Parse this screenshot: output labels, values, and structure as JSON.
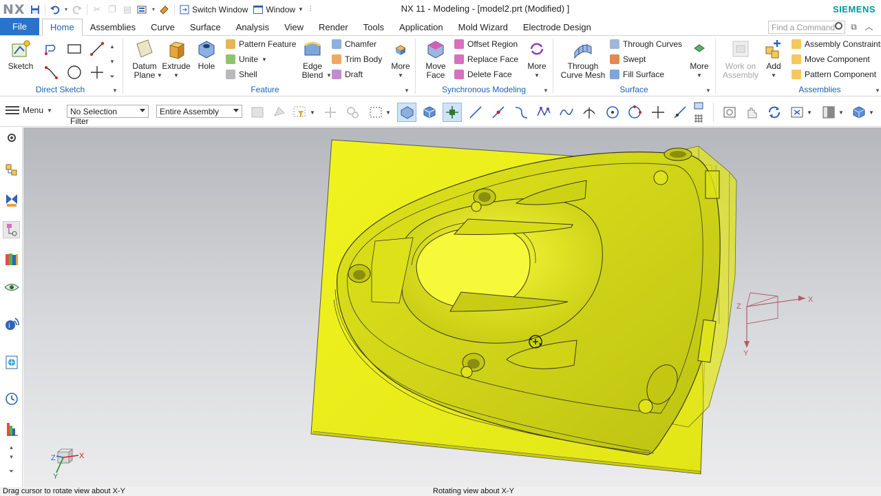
{
  "app": {
    "logo": "NX",
    "title": "NX 11 - Modeling - [model2.prt (Modified) ]",
    "brand": "SIEMENS",
    "switch_window": "Switch Window",
    "window_menu": "Window"
  },
  "tabs": [
    "File",
    "Home",
    "Assemblies",
    "Curve",
    "Surface",
    "Analysis",
    "View",
    "Render",
    "Tools",
    "Application",
    "Mold Wizard",
    "Electrode Design"
  ],
  "active_tab": "Home",
  "search": {
    "placeholder": "Find a Command"
  },
  "ribbon": {
    "direct_sketch": {
      "label": "Direct Sketch",
      "sketch": "Sketch"
    },
    "feature": {
      "label": "Feature",
      "datum_plane": "Datum Plane",
      "extrude": "Extrude",
      "hole": "Hole",
      "pattern_feature": "Pattern Feature",
      "unite": "Unite",
      "shell": "Shell",
      "edge_blend": "Edge Blend",
      "chamfer": "Chamfer",
      "trim_body": "Trim Body",
      "draft": "Draft",
      "more": "More"
    },
    "synchronous": {
      "label": "Synchronous Modeling",
      "move_face": "Move Face",
      "offset_region": "Offset Region",
      "replace_face": "Replace Face",
      "delete_face": "Delete Face",
      "more": "More"
    },
    "surface": {
      "label": "Surface",
      "through_curve_mesh": "Through Curve Mesh",
      "through_curves": "Through Curves",
      "swept": "Swept",
      "fill_surface": "Fill Surface",
      "more": "More"
    },
    "assemblies": {
      "label": "Assemblies",
      "work_on_assembly": "Work on Assembly",
      "add": "Add",
      "assembly_constraints": "Assembly Constraints",
      "move_component": "Move Component",
      "pattern_component": "Pattern Component"
    }
  },
  "toolbar2": {
    "menu": "Menu",
    "selection_filter": "No Selection Filter",
    "scope": "Entire Assembly"
  },
  "viewport": {
    "triad_x": "X",
    "triad_y": "Y",
    "triad_z": "Z",
    "view_triad_x": "X",
    "view_triad_y": "Y",
    "view_triad_z": "Z"
  },
  "status": {
    "left": "Drag cursor to rotate view about X-Y",
    "middle": "Rotating view about X-Y"
  },
  "colors": {
    "accent": "#2b73c9",
    "brand": "#009999",
    "model": "#e6ea1c"
  }
}
